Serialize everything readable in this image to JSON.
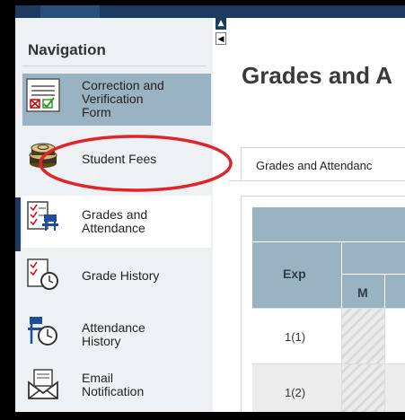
{
  "sidebar": {
    "title": "Navigation",
    "items": [
      {
        "label": "Correction and Verification Form",
        "lines": [
          "Correction and",
          "Verification",
          "Form"
        ],
        "icon": "form-checkbox-icon"
      },
      {
        "label": "Student Fees",
        "lines": [
          "Student Fees"
        ],
        "icon": "coins-icon"
      },
      {
        "label": "Grades and Attendance",
        "lines": [
          "Grades and",
          "Attendance"
        ],
        "icon": "checklist-icon"
      },
      {
        "label": "Grade History",
        "lines": [
          "Grade History"
        ],
        "icon": "grade-history-icon"
      },
      {
        "label": "Attendance History",
        "lines": [
          "Attendance",
          "History"
        ],
        "icon": "attendance-history-icon"
      },
      {
        "label": "Email Notification",
        "lines": [
          "Email",
          "Notification"
        ],
        "icon": "envelope-icon"
      }
    ]
  },
  "main": {
    "page_title": "Grades and A",
    "tab_label": "Grades and Attendanc",
    "table": {
      "header_exp": "Exp",
      "header_m": "M",
      "rows": [
        {
          "exp": "1(1)"
        },
        {
          "exp": "1(2)"
        }
      ]
    }
  },
  "colors": {
    "accent": "#1d3a5f",
    "header": "#9ab3c2",
    "annotation": "#e0242b"
  }
}
